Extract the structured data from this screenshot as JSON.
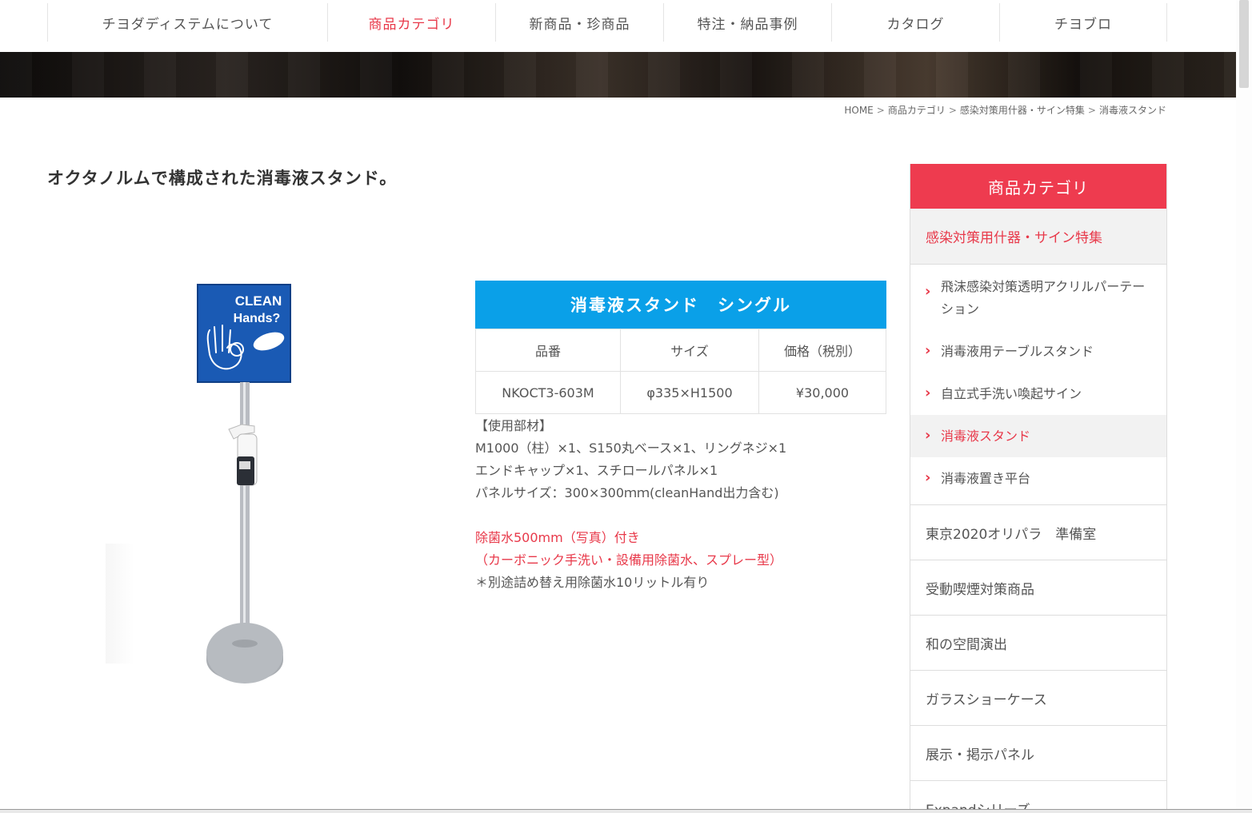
{
  "nav": {
    "items": [
      "チヨダディステムについて",
      "商品カテゴリ",
      "新商品・珍商品",
      "特注・納品事例",
      "カタログ",
      "チヨブロ"
    ],
    "active_index": 1
  },
  "breadcrumb": [
    "HOME",
    "商品カテゴリ",
    "感染対策用什器・サイン特集",
    "消毒液スタンド"
  ],
  "breadcrumb_sep": ">",
  "lead_text": "オクタノルムで構成された消毒液スタンド。",
  "product_image": {
    "sign_text_1": "CLEAN",
    "sign_text_2": "Hands?"
  },
  "spec": {
    "title": "消毒液スタンド　シングル",
    "headers": [
      "品番",
      "サイズ",
      "価格（税別）"
    ],
    "row": [
      "NKOCT3-603M",
      "φ335×H1500",
      "¥30,000"
    ]
  },
  "description": {
    "lines": [
      "【使用部材】",
      "M1000（柱）×1、S150丸ベース×1、リングネジ×1",
      "エンドキャップ×1、スチロールパネル×1",
      "パネルサイズ：300×300ｍｍ(cleanHand出力含む)",
      ""
    ],
    "red_lines": [
      "除菌水500mm（写真）付き",
      "（カーボニック手洗い・設備用除菌水、スプレー型）"
    ],
    "note": "＊別途詰め替え用除菌水10リットル有り"
  },
  "sidebar": {
    "heading": "商品カテゴリ",
    "current_category": "感染対策用什器・サイン特集",
    "sub_items": [
      "飛沫感染対策透明アクリルパーテーション",
      "消毒液用テーブルスタンド",
      "自立式手洗い喚起サイン",
      "消毒液スタンド",
      "消毒液置き平台"
    ],
    "sub_selected_index": 3,
    "categories": [
      "東京2020オリパラ　準備室",
      "受動喫煙対策商品",
      "和の空間演出",
      "ガラスショーケース",
      "展示・掲示パネル",
      "Expandシリーズ"
    ]
  },
  "colors": {
    "accent_red": "#e8394a",
    "sidebar_header": "#ee3b4f",
    "table_header_blue": "#0aa0e8",
    "sign_blue": "#1a5ab4"
  }
}
